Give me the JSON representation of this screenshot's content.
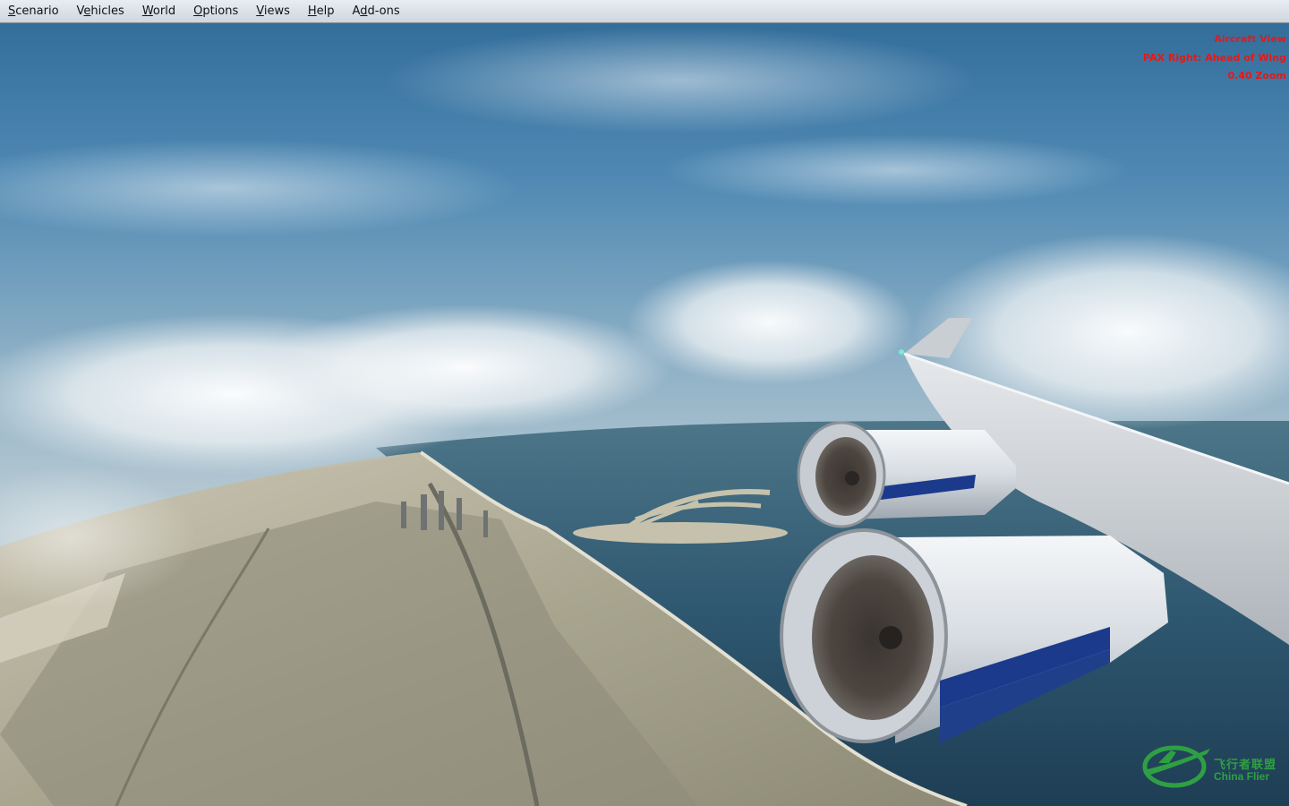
{
  "menu": {
    "items": [
      {
        "name": "scenario",
        "pre": "",
        "acc": "S",
        "post": "cenario"
      },
      {
        "name": "vehicles",
        "pre": "V",
        "acc": "e",
        "post": "hicles"
      },
      {
        "name": "world",
        "pre": "",
        "acc": "W",
        "post": "orld"
      },
      {
        "name": "options",
        "pre": "",
        "acc": "O",
        "post": "ptions"
      },
      {
        "name": "views",
        "pre": "",
        "acc": "V",
        "post": "iews"
      },
      {
        "name": "help",
        "pre": "",
        "acc": "H",
        "post": "elp"
      },
      {
        "name": "add-ons",
        "pre": "A",
        "acc": "d",
        "post": "d-ons"
      }
    ]
  },
  "view_info": {
    "line1": "Aircraft View",
    "line2": "PAX Right: Ahead of Wing",
    "line3": "0.40 Zoom"
  },
  "watermark": {
    "cn": "飞行者联盟",
    "en": "China Flier"
  },
  "colors": {
    "overlay_text": "#e21a1a",
    "watermark": "#2ea043",
    "engine_stripe": "#1b3a8c"
  }
}
